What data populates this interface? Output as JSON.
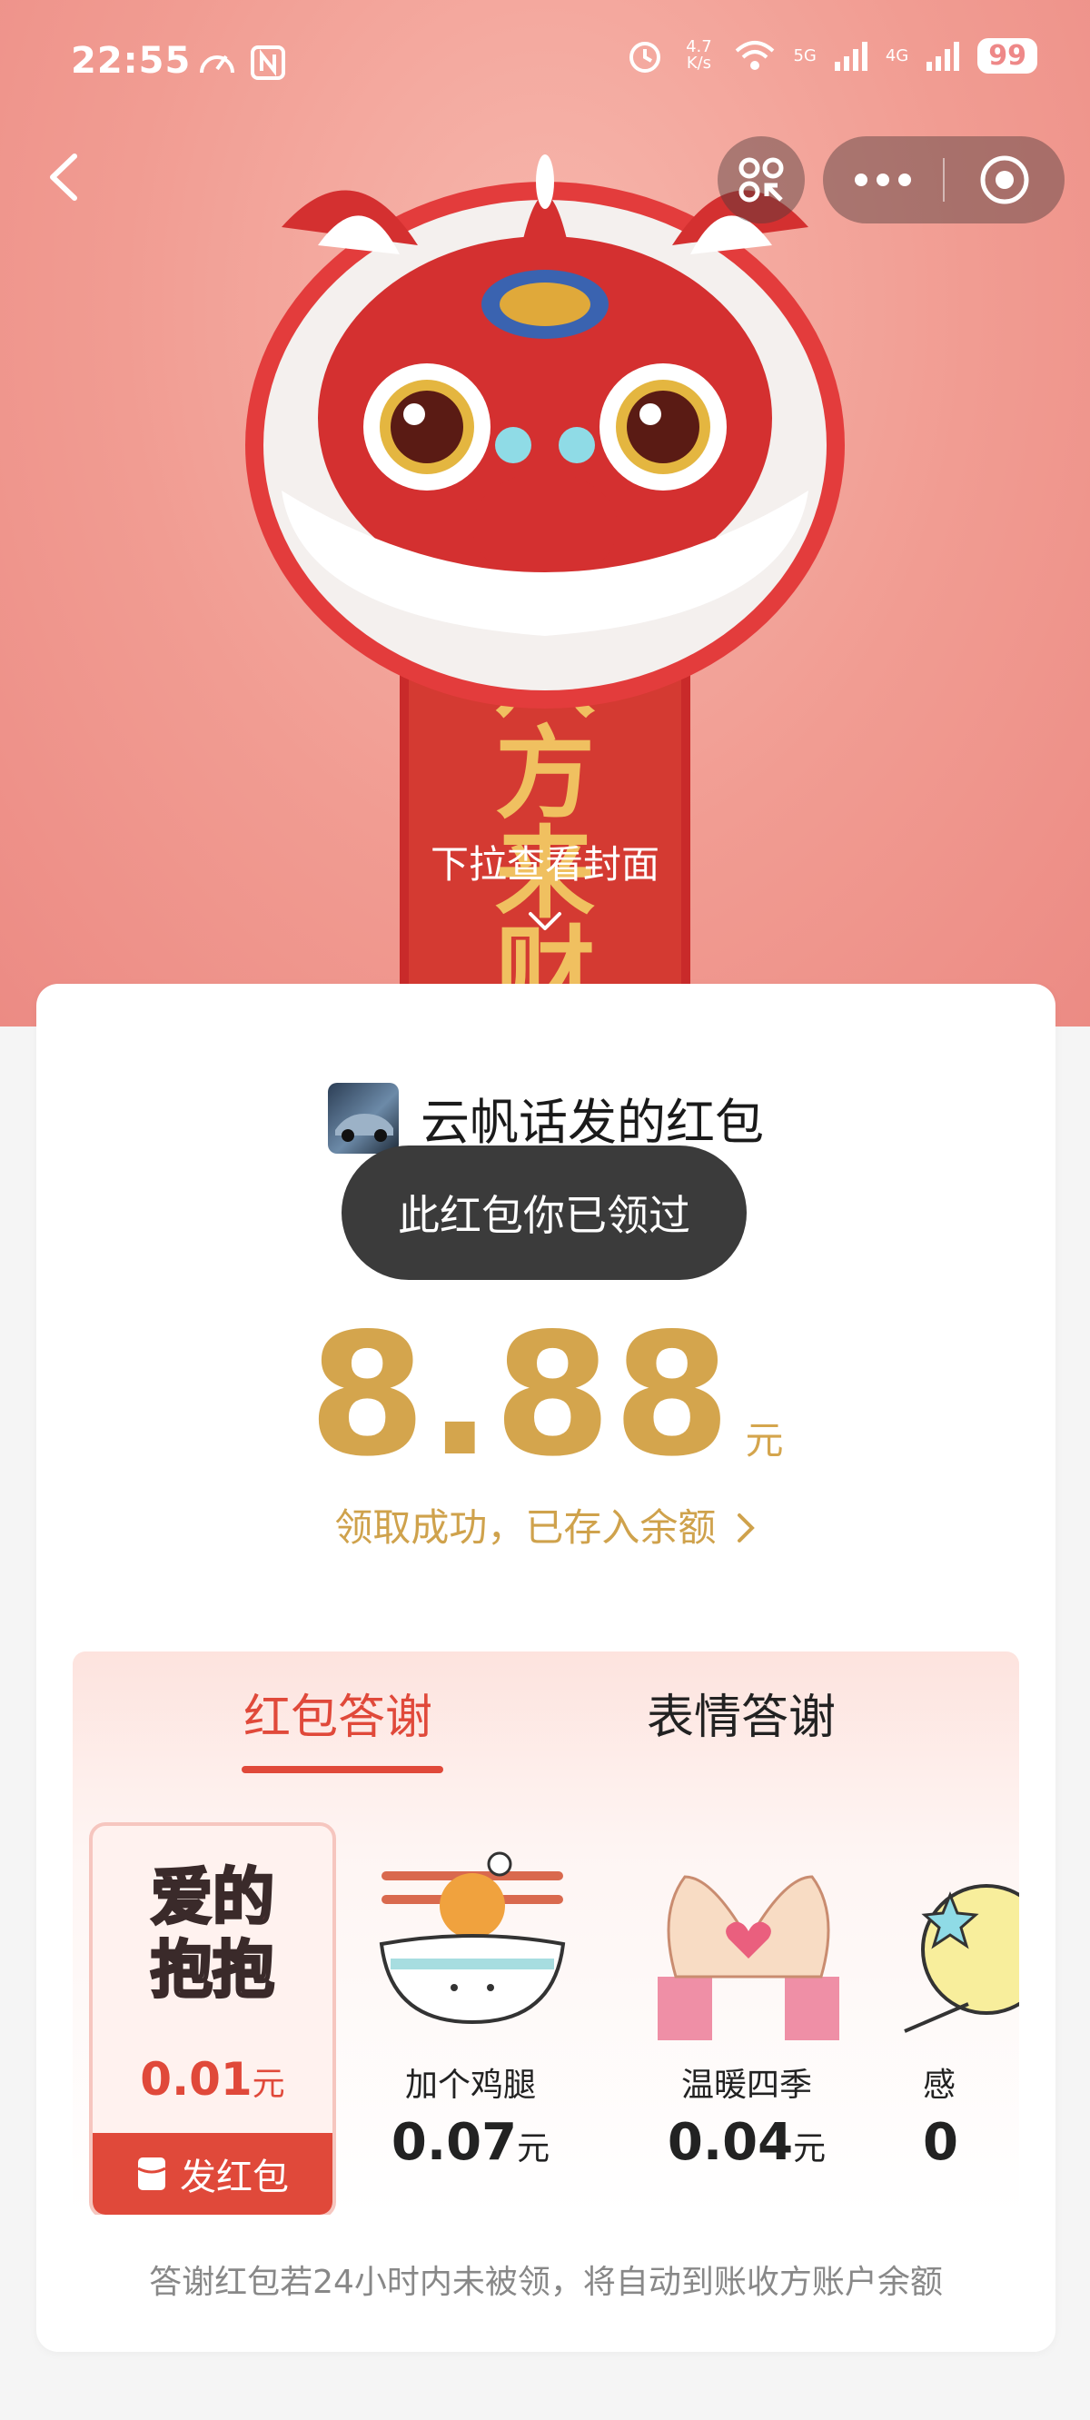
{
  "status_bar": {
    "time": "22:55",
    "net_speed": "4.7\nK/s",
    "signal_5g": "5G",
    "signal_4g": "4G",
    "battery": "99"
  },
  "cover": {
    "banner_text": "八方来财",
    "pull_hint": "下拉查看封面"
  },
  "envelope": {
    "sender_title": "云帆话发的红包",
    "blessing": "财",
    "toast": "此红包你已领过",
    "amount": "8.88",
    "amount_unit": "元",
    "success_text": "领取成功，已存入余额",
    "accent_color": "#d4a54d"
  },
  "thanks": {
    "tabs": [
      {
        "label": "红包答谢",
        "active": true
      },
      {
        "label": "表情答谢",
        "active": false
      }
    ],
    "items": [
      {
        "sticker_text_1": "爱的",
        "sticker_text_2": "抱抱",
        "price": "0.01",
        "unit": "元",
        "selected": true,
        "action": "发红包"
      },
      {
        "label": "加个鸡腿",
        "price": "0.07",
        "unit": "元"
      },
      {
        "label": "温暖四季",
        "price": "0.04",
        "unit": "元"
      },
      {
        "label": "感",
        "price": "0",
        "unit": ""
      }
    ],
    "footnote": "答谢红包若24小时内未被领，将自动到账收方账户余额",
    "active_color": "#e0493a"
  }
}
